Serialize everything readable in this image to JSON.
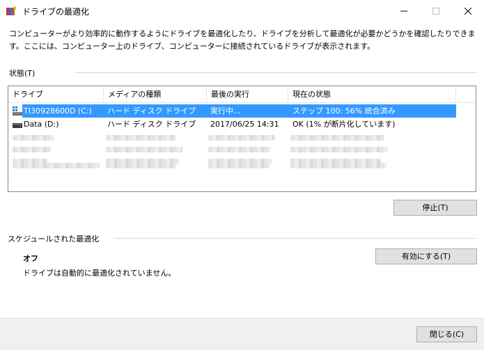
{
  "window": {
    "title": "ドライブの最適化",
    "accent": "#3399ff"
  },
  "description": "コンピューターがより効率的に動作するようにドライブを最適化したり、ドライブを分析して最適化が必要かどうかを確認したりできます。ここには、コンピューター上のドライブ、コンピューターに接続されているドライブが表示されます。",
  "status_section": {
    "label": "状態(T)",
    "columns": [
      "ドライブ",
      "メディアの種類",
      "最後の実行",
      "現在の状態"
    ],
    "rows": [
      {
        "drive": "TI30928600D (C:)",
        "media": "ハード ディスク ドライブ",
        "last_run": "実行中...",
        "status": "ステップ 100: 56% 統合済み",
        "selected": true,
        "icon": "system-drive-icon"
      },
      {
        "drive": "Data (D:)",
        "media": "ハード ディスク ドライブ",
        "last_run": "2017/06/25 14:31",
        "status": "OK (1% が断片化しています)",
        "selected": false,
        "icon": "drive-icon"
      }
    ],
    "stop_button": "停止(T)"
  },
  "schedule_section": {
    "label": "スケジュールされた最適化",
    "state": "オフ",
    "description": "ドライブは自動的に最適化されていません。",
    "enable_button": "有効にする(T)"
  },
  "footer": {
    "close_button": "閉じる(C)"
  }
}
